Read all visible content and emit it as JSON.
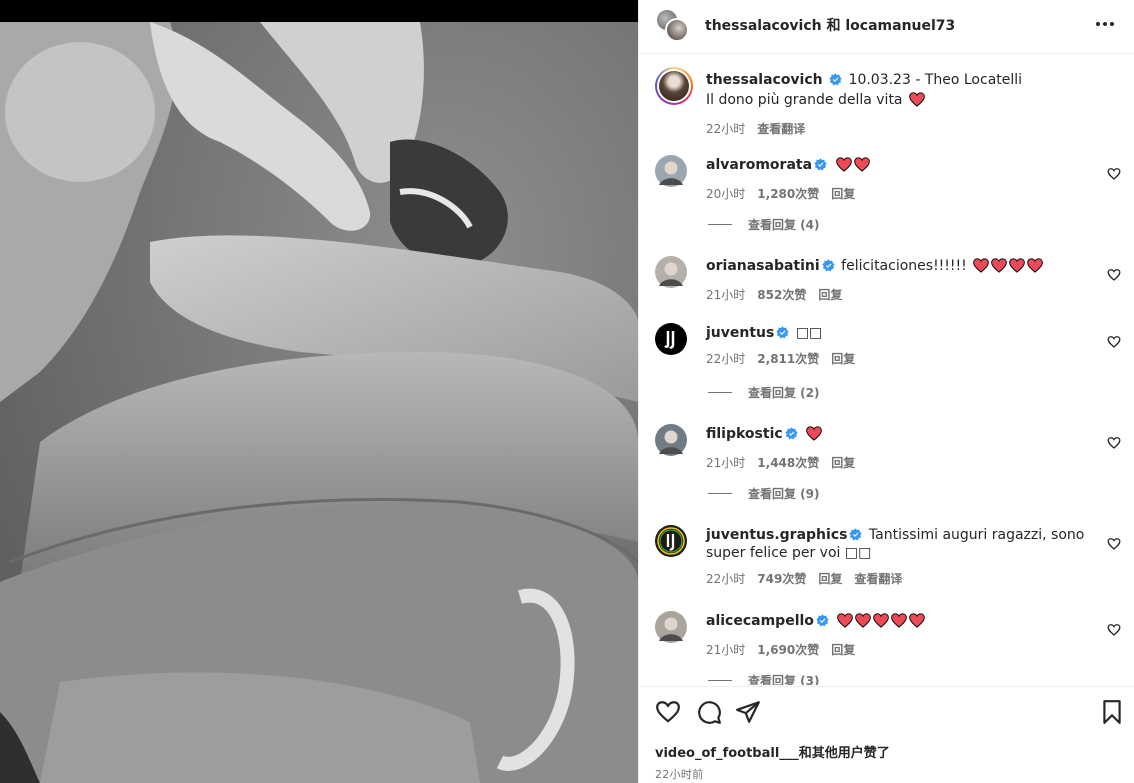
{
  "header": {
    "title": "thessalacovich 和 locamanuel73"
  },
  "caption": {
    "username": "thessalacovich",
    "text": "10.03.23 - Theo Locatelli",
    "text2": "Il dono più grande della vita",
    "time": "22小时",
    "translate": "查看翻译"
  },
  "comments": [
    {
      "username": "alvaromorata",
      "text": "",
      "hearts": 2,
      "time": "20小时",
      "likes": "1,280次赞",
      "reply": "回复",
      "view_replies": "查看回复 (4)",
      "avatar_color": "#9aa7b0"
    },
    {
      "username": "orianasabatini",
      "text": "felicitaciones!!!!!!",
      "hearts": 4,
      "time": "21小时",
      "likes": "852次赞",
      "reply": "回复",
      "view_replies": "",
      "avatar_color": "#b5b0a9"
    },
    {
      "username": "juventus",
      "text": "□□",
      "hearts": 0,
      "time": "22小时",
      "likes": "2,811次赞",
      "reply": "回复",
      "view_replies": "查看回复 (2)",
      "avatar_color": "#000000"
    },
    {
      "username": "filipkostic",
      "text": "",
      "hearts": 1,
      "time": "21小时",
      "likes": "1,448次赞",
      "reply": "回复",
      "view_replies": "查看回复 (9)",
      "avatar_color": "#6f7c86"
    },
    {
      "username": "juventus.graphics",
      "text": "Tantissimi auguri ragazzi, sono super felice per voi □□",
      "hearts": 0,
      "time": "22小时",
      "likes": "749次赞",
      "reply": "回复",
      "translate": "查看翻译",
      "view_replies": "",
      "avatar_color": "#000000"
    },
    {
      "username": "alicecampello",
      "text": "",
      "hearts": 5,
      "time": "21小时",
      "likes": "1,690次赞",
      "reply": "回复",
      "view_replies": "查看回复 (3)",
      "avatar_color": "#a9a49c"
    }
  ],
  "footer": {
    "liked_by_user": "video_of_football___",
    "liked_by_rest": "和其他用户赞了",
    "time": "22小时前"
  },
  "icons": {
    "like": "heart-outline-icon",
    "comment": "comment-bubble-icon",
    "share": "paper-plane-icon",
    "save": "bookmark-icon",
    "more": "more-horizontal-icon",
    "verified": "verified-badge-icon"
  },
  "colors": {
    "verified": "#3897f0",
    "heart": "#ed4956",
    "muted": "#737373",
    "text": "#262626"
  }
}
